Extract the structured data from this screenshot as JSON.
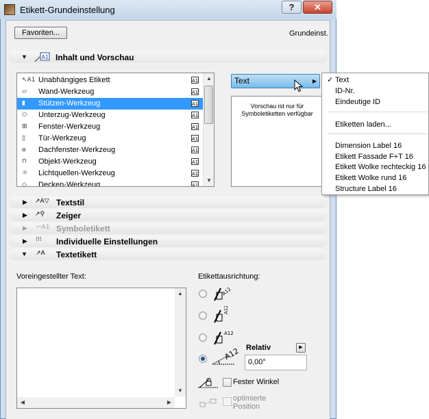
{
  "window": {
    "title": "Etikett-Grundeinstellung",
    "help_label": "?",
    "close_label": "✕"
  },
  "toolbar": {
    "favorites_label": "Favoriten...",
    "default_label": "Grundeinst."
  },
  "sections": {
    "inhalt": "Inhalt und Vorschau",
    "textstil": "Textstil",
    "zeiger": "Zeiger",
    "symbol": "Symboletikett",
    "individuell": "Individuelle Einstellungen",
    "textetikett": "Textetikett"
  },
  "tool_list": [
    {
      "label": "Unabhängiges Etikett",
      "icon": "independent-label-icon",
      "glyph": "↖A1"
    },
    {
      "label": "Wand-Werkzeug",
      "icon": "wall-tool-icon",
      "glyph": "▱"
    },
    {
      "label": "Stützen-Werkzeug",
      "icon": "column-tool-icon",
      "glyph": "▮"
    },
    {
      "label": "Unterzug-Werkzeug",
      "icon": "beam-tool-icon",
      "glyph": "⬭"
    },
    {
      "label": "Fenster-Werkzeug",
      "icon": "window-tool-icon",
      "glyph": "⊞"
    },
    {
      "label": "Tür-Werkzeug",
      "icon": "door-tool-icon",
      "glyph": "▯"
    },
    {
      "label": "Dachfenster-Werkzeug",
      "icon": "skylight-tool-icon",
      "glyph": "⧈"
    },
    {
      "label": "Objekt-Werkzeug",
      "icon": "object-tool-icon",
      "glyph": "⊓"
    },
    {
      "label": "Lichtquellen-Werkzeug",
      "icon": "lamp-tool-icon",
      "glyph": "☼"
    },
    {
      "label": "Decken-Werkzeug",
      "icon": "slab-tool-icon",
      "glyph": "◇"
    }
  ],
  "tool_list_selected": 2,
  "a1_badge": "A1",
  "content_type": {
    "selected": "Text"
  },
  "preview": {
    "message": "Vorschau ist nur für Symboletiketten verfügbar"
  },
  "menu": {
    "group1": [
      "Text",
      "ID-Nr.",
      "Eindeutige ID"
    ],
    "checked": "✓",
    "group2": [
      "Etiketten laden..."
    ],
    "group3": [
      "Dimension Label 16",
      "Etikett Fassade F+T 16",
      "Etikett Wolke rechteckig 16",
      "Etikett Wolke rund 16",
      "Structure Label 16"
    ]
  },
  "textetikett": {
    "preset_text_label": "Voreingestellter Text:",
    "alignment_label": "Etikettausrichtung:",
    "relative_label": "Relativ",
    "angle_value": "0,00°",
    "fixed_angle_label": "Fester Winkel",
    "optimized_label_1": "optimierte",
    "optimized_label_2": "Position",
    "radio_selected": 3
  },
  "colors": {
    "selection": "#3399ff",
    "dropdown_accent": "#79bbea",
    "close_button": "#c7422d"
  }
}
